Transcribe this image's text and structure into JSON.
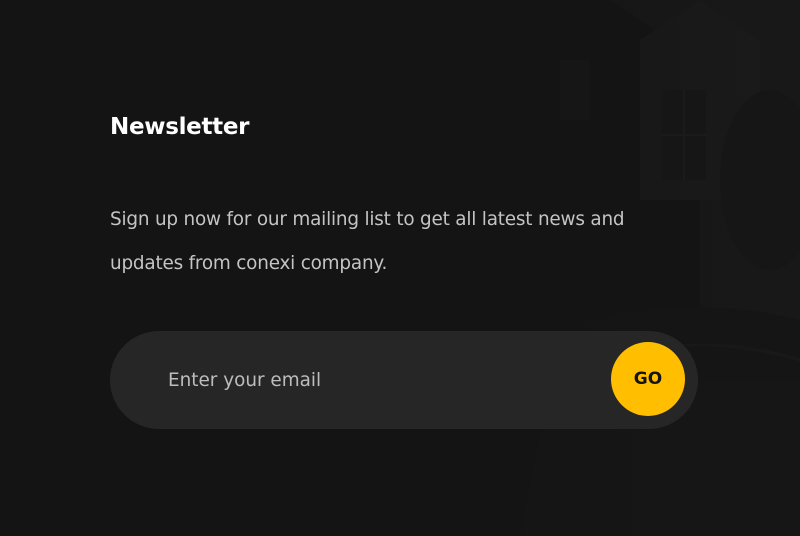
{
  "newsletter": {
    "title": "Newsletter",
    "description": "Sign up now for our mailing list to get all latest news and updates from conexi company.",
    "email_placeholder": "Enter your email",
    "go_label": "GO"
  },
  "colors": {
    "background": "#141414",
    "input_background": "#262626",
    "accent": "#ffbe00",
    "title_text": "#ffffff",
    "body_text": "#c4c4c4"
  },
  "icons": {
    "background_image": "house-photo-background"
  }
}
